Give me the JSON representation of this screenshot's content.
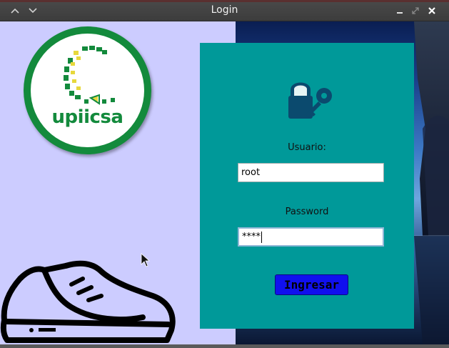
{
  "window": {
    "title": "Login",
    "controls": [
      "chevron-up",
      "chevron-down",
      "minimize",
      "maximize",
      "close"
    ]
  },
  "logo": {
    "text": "upiicsa",
    "color": "#138a3c"
  },
  "login": {
    "user_label": "Usuario:",
    "user_value": "root",
    "password_label": "Password",
    "password_value": "****",
    "submit_label": "Ingresar"
  },
  "colors": {
    "left_panel": "#ccccff",
    "card": "#009999",
    "button": "#1010ee"
  }
}
